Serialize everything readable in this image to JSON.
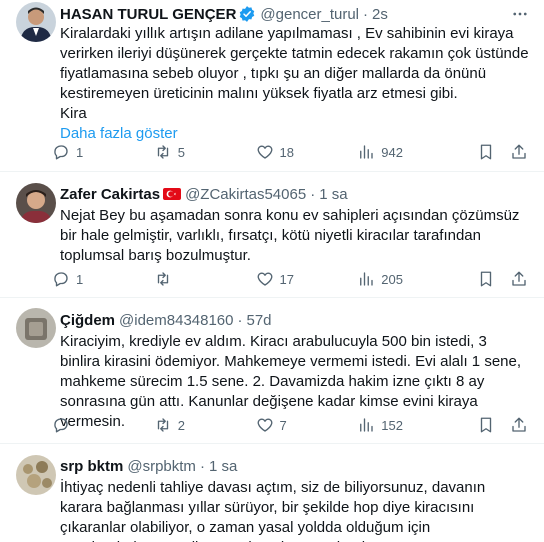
{
  "tweets": [
    {
      "name": "HASAN TURUL GENÇER",
      "verified": true,
      "handle": "@gencer_turul",
      "time": "2s",
      "text": "Kiralardaki yıllık artışın adilane yapılmaması , Ev sahibinin evi kiraya verirken ileriyi düşünerek gerçekte tatmin edecek rakamın çok üstünde fiyatlamasına sebeb oluyor , tıpkı şu an diğer mallarda da önünü kestiremeyen üreticinin malını yüksek fiyatla arz etmesi gibi.\nKira",
      "show_more": "Daha fazla göster",
      "replies": "1",
      "retweets": "5",
      "likes": "18",
      "views": "942"
    },
    {
      "name": "Zafer Cakirtas",
      "flag": "turkey-flag",
      "handle": "@ZCakirtas54065",
      "time": "1 sa",
      "text": "Nejat Bey bu aşamadan sonra konu ev sahipleri açısından çözümsüz bir hale gelmiştir, varlıklı, fırsatçı, kötü niyetli kiracılar tarafından toplumsal barış bozulmuştur.",
      "replies": "1",
      "retweets": "",
      "likes": "17",
      "views": "205"
    },
    {
      "name": "Çiğdem",
      "handle": "@idem84348160",
      "time": "57d",
      "text": "Kiraciyim, krediyle ev aldım. Kiracı arabulucuyla 500 bin istedi, 3 binlira kirasini ödemiyor. Mahkemeye vermemi istedi. Evi alalı 1 sene, mahkeme sürecim 1.5 sene. 2. Davamizda hakim izne çıktı 8 ay sonrasına gün attı. Kanunlar değişene kadar kimse evini kiraya vermesin.",
      "replies": "",
      "retweets": "2",
      "likes": "7",
      "views": "152"
    },
    {
      "name": "srp bktm",
      "handle": "@srpbktm",
      "time": "1 sa",
      "text": "İhtiyaç nedenli tahliye davası açtım, siz de biliyorsunuz, davanın karara bağlanması yıllar sürüyor, bir şekilde hop diye kiracısını çıkaranlar olabiliyor, o zaman yasal yoldda olduğum için cezalandırılıyorum diyorum, ister istemez hırslanıyorum."
    }
  ],
  "colors": {
    "accent": "#1d9bf0",
    "muted": "#536471",
    "text": "#0f1419",
    "border": "#eff3f4"
  }
}
